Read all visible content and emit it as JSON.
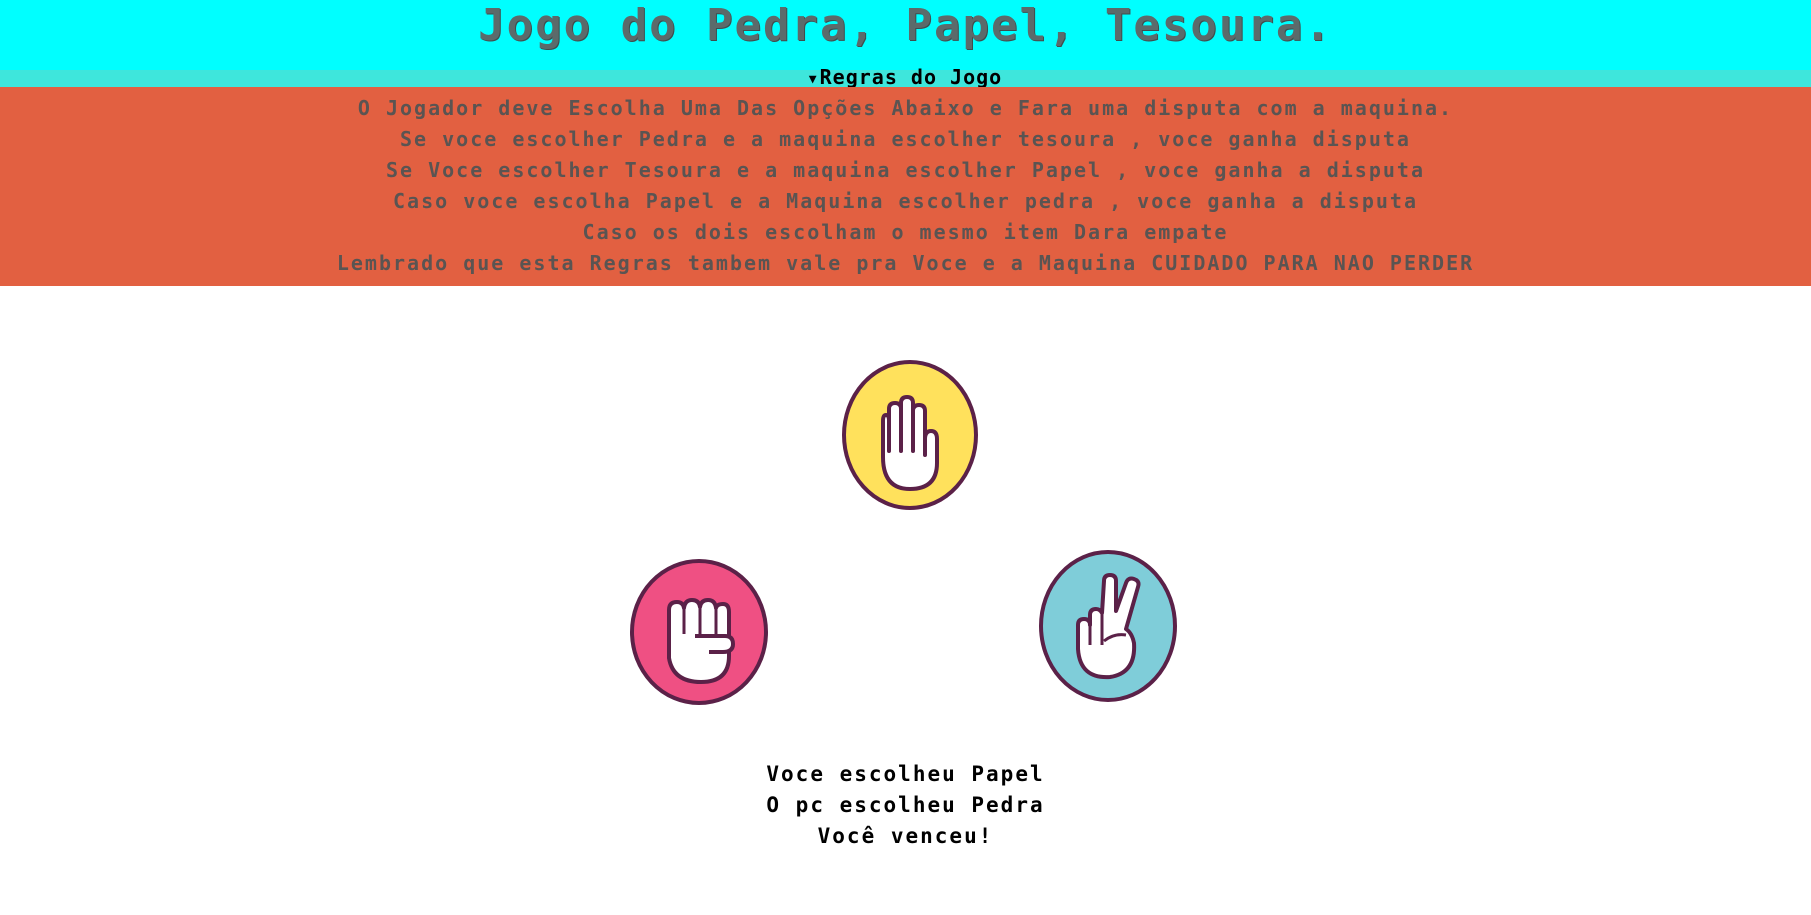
{
  "header": {
    "title": "Jogo do Pedra, Papel, Tesoura."
  },
  "rules": {
    "summary": "Regras do Jogo",
    "lines": [
      "O Jogador deve Escolha Uma Das Opções Abaixo e Fara uma disputa com a maquina.",
      "Se voce escolher Pedra e a maquina escolher tesoura , voce ganha disputa",
      "Se Voce escolher Tesoura e a maquina escolher Papel , voce ganha a disputa",
      "Caso voce escolha Papel e a Maquina escolher pedra , voce ganha a disputa",
      "Caso os dois escolham o mesmo item Dara empate",
      "Lembrado que esta Regras tambem vale pra Voce e a Maquina CUIDADO PARA NAO PERDER"
    ]
  },
  "choices": {
    "paper": {
      "icon": "open-hand-icon",
      "color": "#ffe15c"
    },
    "rock": {
      "icon": "fist-icon",
      "color": "#ef5083"
    },
    "scissors": {
      "icon": "peace-hand-icon",
      "color": "#7fcdd9"
    }
  },
  "colors": {
    "header_bg": "#00ffff",
    "summary_bg": "#3ee6dc",
    "rules_bg": "#e26041",
    "icon_outline": "#5b2148"
  },
  "result": {
    "player": "Voce escolheu Papel",
    "pc": "O pc escolheu Pedra",
    "outcome": "Você venceu!"
  }
}
